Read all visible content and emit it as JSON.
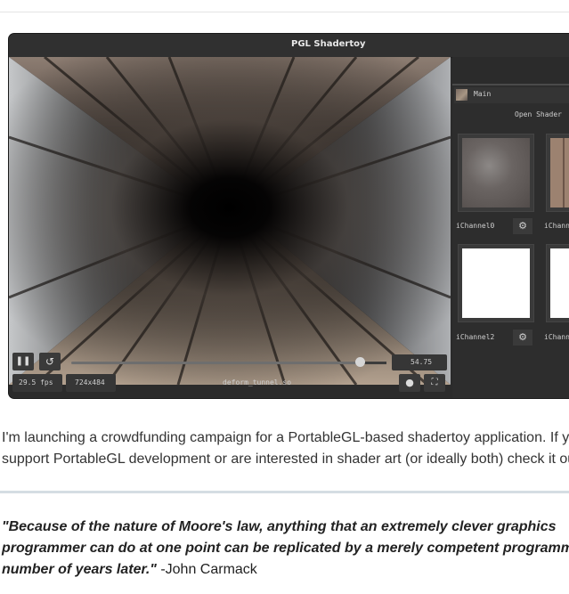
{
  "page": {
    "heading_fragment": "...g..."
  },
  "window": {
    "title": "PGL Shadertoy"
  },
  "panel": {
    "main_label": "Main",
    "open_shader": "Open Shader",
    "channels": [
      {
        "label": "iChannel0"
      },
      {
        "label": "iChann"
      },
      {
        "label": "iChannel2"
      },
      {
        "label": "iChann"
      }
    ],
    "gear_icon": "gear-icon"
  },
  "controls": {
    "pause_icon": "pause-icon",
    "restart_icon": "restart-icon",
    "time": "54.75",
    "slider_value": 0.93,
    "fps": "29.5 fps",
    "resolution": "724x484",
    "shader_file": "deform_tunnel.so",
    "record_icon": "record-icon",
    "fullscreen_icon": "fullscreen-icon"
  },
  "article": {
    "para_line1": "I'm launching a crowdfunding campaign for a PortableGL-based shadertoy application. If y",
    "para_line2": "support PortableGL development or are interested in shader art (or ideally both) check it ou",
    "quote_line1": "\"Because of the nature of Moore's law, anything that an extremely clever graphics",
    "quote_line2": "programmer can do at one point can be replicated by a merely competent programm",
    "quote_line3_bold": "number of years later.\"",
    "quote_author": " -John Carmack"
  }
}
